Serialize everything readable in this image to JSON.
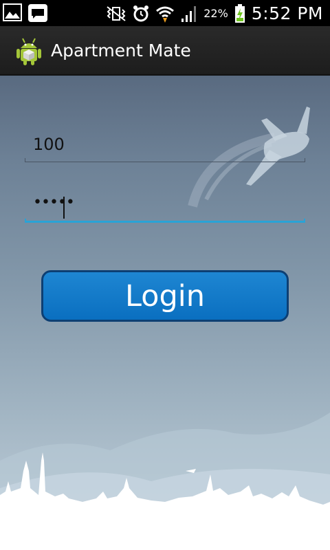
{
  "status_bar": {
    "battery_percent": "22%",
    "time": "5:52 PM",
    "icons": [
      "gallery-icon",
      "messaging-icon",
      "vibrate-mute-icon",
      "alarm-icon",
      "wifi-icon",
      "signal-icon",
      "battery-charging-icon"
    ]
  },
  "action_bar": {
    "app_icon": "android-icon",
    "title": "Apartment Mate"
  },
  "form": {
    "username_value": "100",
    "password_value": "•••••",
    "login_label": "Login"
  },
  "colors": {
    "accent": "#29a3d6",
    "button": "#0a6fc0",
    "action_bar": "#1d1d1d"
  }
}
